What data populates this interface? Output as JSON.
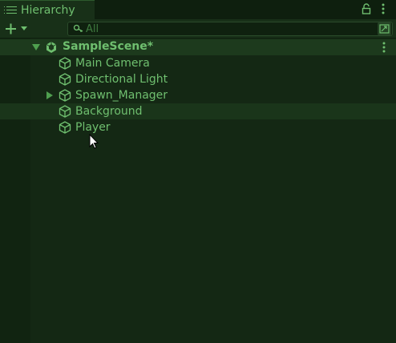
{
  "panel": {
    "tab_label": "Hierarchy",
    "lock_icon": "lock-icon",
    "menu_icon": "kebab-menu-icon"
  },
  "toolbar": {
    "add_icon": "plus-icon",
    "dropdown_icon": "caret-down-icon",
    "search_placeholder": "All",
    "search_value": ""
  },
  "scene": {
    "name": "SampleScene*",
    "expanded": true
  },
  "items": [
    {
      "label": "Main Camera",
      "has_children": false,
      "selected": false
    },
    {
      "label": "Directional Light",
      "has_children": false,
      "selected": false
    },
    {
      "label": "Spawn_Manager",
      "has_children": true,
      "selected": false
    },
    {
      "label": "Background",
      "has_children": false,
      "selected": true
    },
    {
      "label": "Player",
      "has_children": false,
      "selected": false
    }
  ],
  "colors": {
    "background": "#142814",
    "text": "#6fbf6f",
    "selection": "#1a351a"
  }
}
